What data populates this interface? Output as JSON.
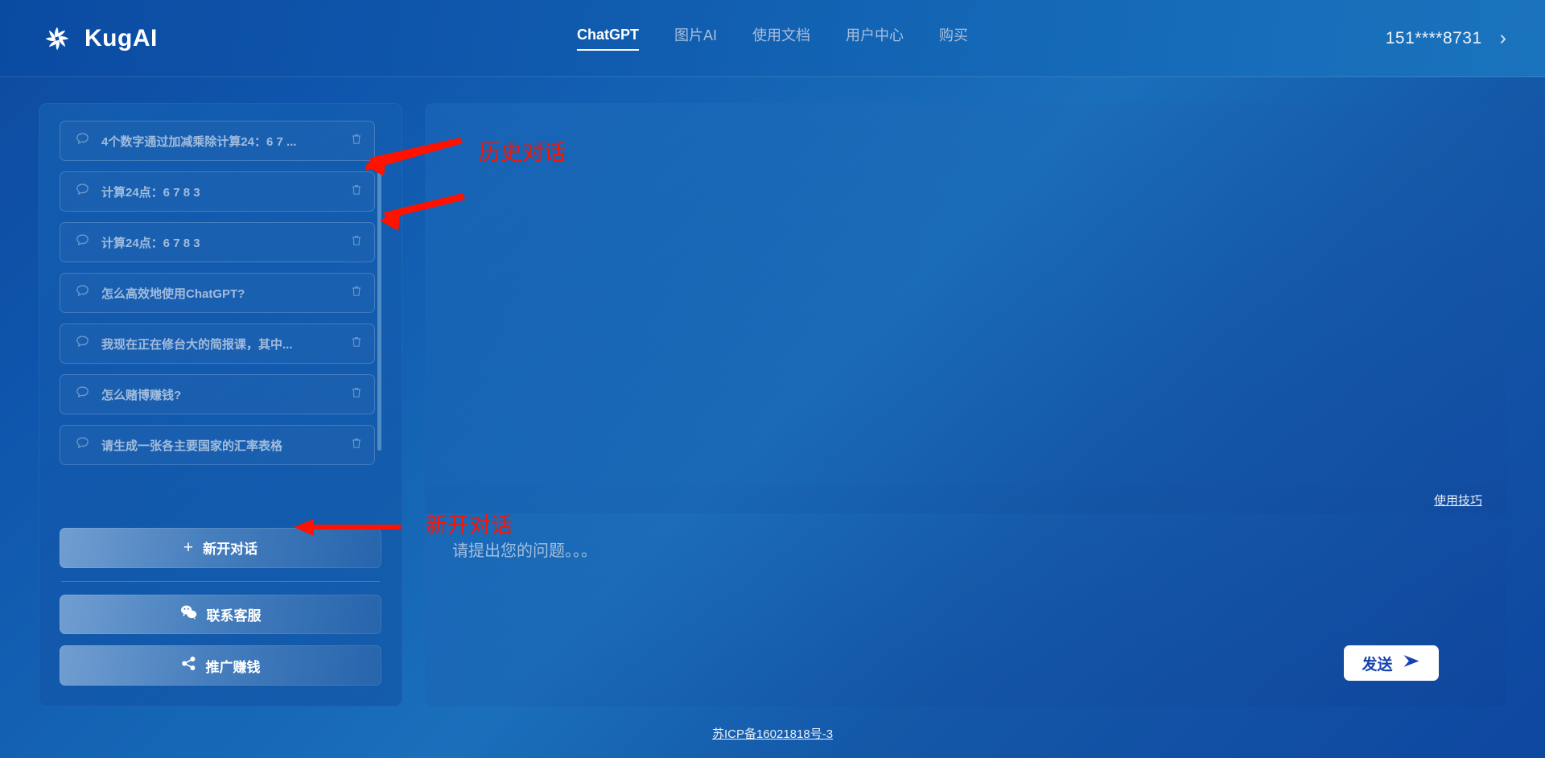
{
  "header": {
    "brand": "KugAI",
    "brand_icon": "asterisk-logo-icon",
    "nav": [
      {
        "label": "ChatGPT",
        "active": true
      },
      {
        "label": "图片AI",
        "active": false
      },
      {
        "label": "使用文档",
        "active": false
      },
      {
        "label": "用户中心",
        "active": false
      },
      {
        "label": "购买",
        "active": false
      }
    ],
    "user_phone": "151****8731",
    "chevron": "›"
  },
  "sidebar": {
    "history": [
      {
        "label": "4个数字通过加减乘除计算24：6 7 ..."
      },
      {
        "label": "计算24点：6 7 8 3"
      },
      {
        "label": "计算24点：6 7 8 3"
      },
      {
        "label": "怎么高效地使用ChatGPT?"
      },
      {
        "label": "我现在正在修台大的简报课，其中..."
      },
      {
        "label": "怎么赌博赚钱?"
      },
      {
        "label": "请生成一张各主要国家的汇率表格"
      }
    ],
    "new_chat": {
      "label": "新开对话",
      "plus": "+"
    },
    "contact": {
      "label": "联系客服",
      "icon": "wechat-icon"
    },
    "promote": {
      "label": "推广赚钱",
      "icon": "share-icon"
    }
  },
  "main": {
    "tips_link": "使用技巧",
    "composer_placeholder": "请提出您的问题。。。",
    "composer_value": "",
    "send_label": "发送",
    "send_icon": "send-triangle-icon"
  },
  "footer": {
    "icp": "苏ICP备16021818号-3"
  },
  "annotations": {
    "color": "#ff1200",
    "history_label": "历史对话",
    "new_chat_label": "新开对话"
  }
}
